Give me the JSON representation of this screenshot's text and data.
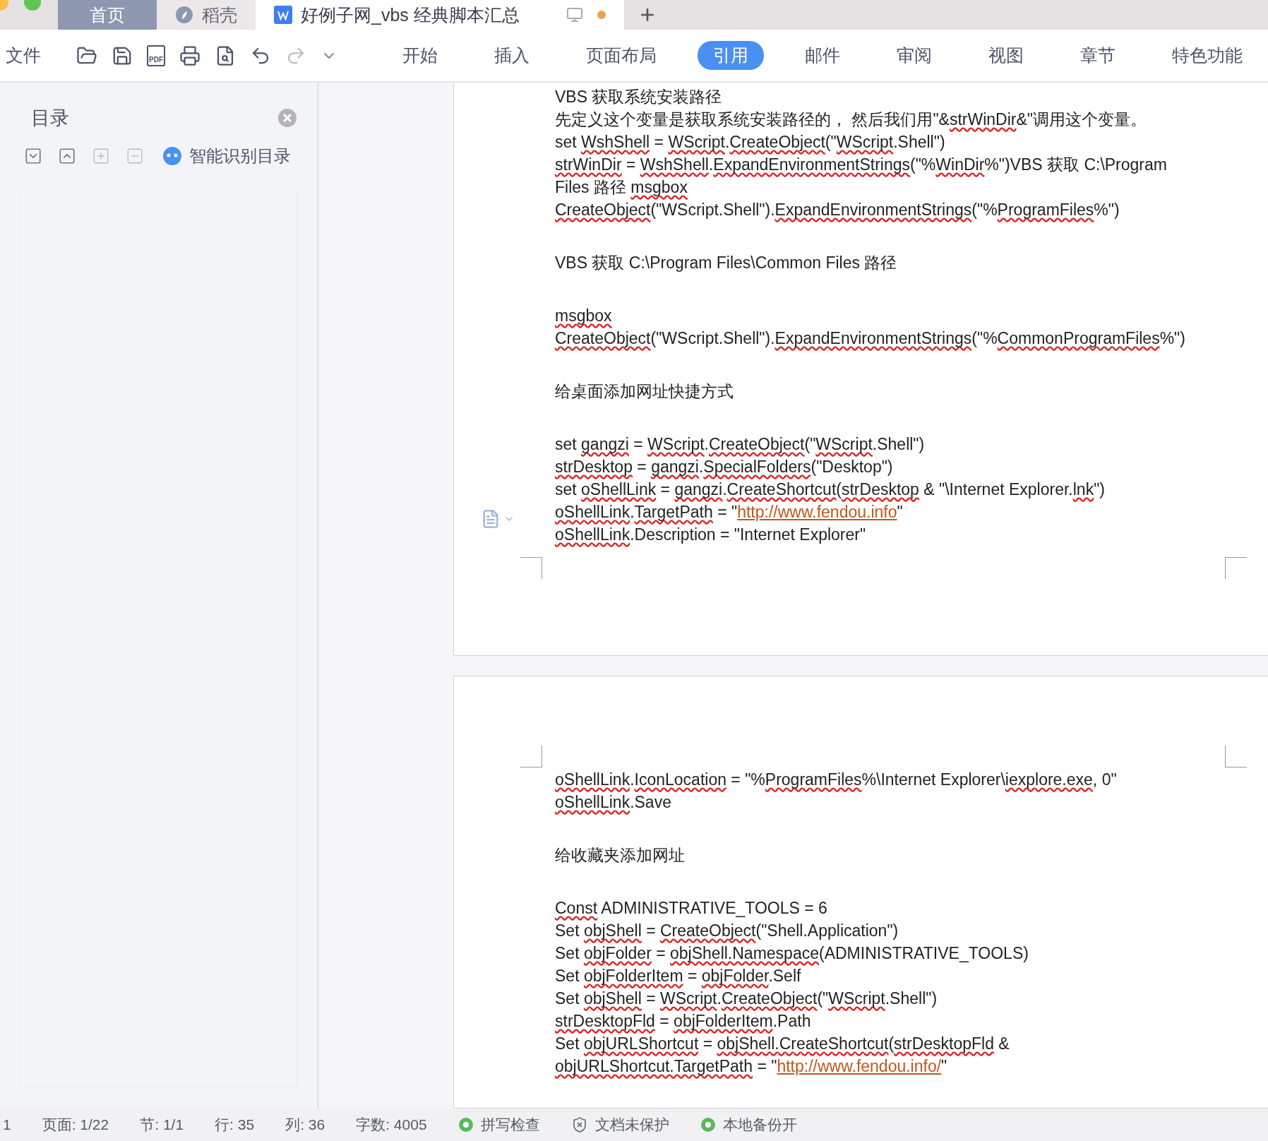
{
  "tab_bar": {
    "tabs": [
      {
        "label": "首页",
        "kind": "home",
        "selected": false
      },
      {
        "label": "稻壳",
        "kind": "store",
        "selected": false
      },
      {
        "label": "好例子网_vbs 经典脚本汇总",
        "kind": "document",
        "selected": true
      }
    ]
  },
  "toolbar": {
    "file_menu": "文件",
    "pdf_label": "PDF",
    "ribbon_tabs": [
      {
        "label": "开始",
        "selected": false
      },
      {
        "label": "插入",
        "selected": false
      },
      {
        "label": "页面布局",
        "selected": false
      },
      {
        "label": "引用",
        "selected": true
      },
      {
        "label": "邮件",
        "selected": false
      },
      {
        "label": "审阅",
        "selected": false
      },
      {
        "label": "视图",
        "selected": false
      },
      {
        "label": "章节",
        "selected": false
      },
      {
        "label": "特色功能",
        "selected": false
      }
    ]
  },
  "sidebar": {
    "title": "目录",
    "smart_button": "智能识别目录"
  },
  "pages": [
    {
      "blocks": [
        [
          [
            {
              "text": "VBS 获取系统安装路径",
              "kind": "plain"
            }
          ],
          [
            {
              "text": "先定义这个变量是获取系统安装路径的， 然后我们用\"&",
              "kind": "plain"
            },
            {
              "text": "strWinDir",
              "kind": "spell"
            },
            {
              "text": "&\"调用这个变量。",
              "kind": "plain"
            }
          ],
          [
            {
              "text": "set ",
              "kind": "plain"
            },
            {
              "text": "WshShell",
              "kind": "spell"
            },
            {
              "text": " = ",
              "kind": "plain"
            },
            {
              "text": "WScript",
              "kind": "spell"
            },
            {
              "text": ".",
              "kind": "plain"
            },
            {
              "text": "CreateObject",
              "kind": "spell"
            },
            {
              "text": "(\"",
              "kind": "plain"
            },
            {
              "text": "WScript",
              "kind": "spell"
            },
            {
              "text": ".Shell\")",
              "kind": "plain"
            }
          ],
          [
            {
              "text": "strWinDir",
              "kind": "spell"
            },
            {
              "text": " = ",
              "kind": "plain"
            },
            {
              "text": "WshShell",
              "kind": "spell"
            },
            {
              "text": ".",
              "kind": "plain"
            },
            {
              "text": "ExpandEnvironmentStrings",
              "kind": "spell"
            },
            {
              "text": "(\"%",
              "kind": "plain"
            },
            {
              "text": "WinDir",
              "kind": "spell"
            },
            {
              "text": "%\")VBS 获取 C:\\Program",
              "kind": "plain"
            }
          ],
          [
            {
              "text": "Files 路径 ",
              "kind": "plain"
            },
            {
              "text": "msgbox",
              "kind": "spell"
            }
          ],
          [
            {
              "text": "CreateObject",
              "kind": "spell"
            },
            {
              "text": "(\"WScript.Shell\").",
              "kind": "plain"
            },
            {
              "text": "ExpandEnvironmentStrings",
              "kind": "spell"
            },
            {
              "text": "(\"%",
              "kind": "plain"
            },
            {
              "text": "ProgramFiles",
              "kind": "spell"
            },
            {
              "text": "%\")",
              "kind": "plain"
            }
          ]
        ],
        [
          [
            {
              "text": "VBS 获取 C:\\Program Files\\Common Files 路径",
              "kind": "plain"
            }
          ]
        ],
        [
          [
            {
              "text": "msgbox",
              "kind": "spell"
            }
          ],
          [
            {
              "text": "CreateObject",
              "kind": "spell"
            },
            {
              "text": "(\"WScript.Shell\").",
              "kind": "plain"
            },
            {
              "text": "ExpandEnvironmentStrings",
              "kind": "spell"
            },
            {
              "text": "(\"%",
              "kind": "plain"
            },
            {
              "text": "CommonProgramFiles",
              "kind": "spell"
            },
            {
              "text": "%\")",
              "kind": "plain"
            }
          ]
        ],
        [
          [
            {
              "text": "给桌面添加网址快捷方式",
              "kind": "plain"
            }
          ]
        ],
        [
          [
            {
              "text": "set ",
              "kind": "plain"
            },
            {
              "text": "gangzi",
              "kind": "spell"
            },
            {
              "text": " = ",
              "kind": "plain"
            },
            {
              "text": "WScript",
              "kind": "spell"
            },
            {
              "text": ".",
              "kind": "plain"
            },
            {
              "text": "CreateObject",
              "kind": "spell"
            },
            {
              "text": "(\"",
              "kind": "plain"
            },
            {
              "text": "WScript",
              "kind": "spell"
            },
            {
              "text": ".Shell\")",
              "kind": "plain"
            }
          ],
          [
            {
              "text": "strDesktop",
              "kind": "spell"
            },
            {
              "text": " = ",
              "kind": "plain"
            },
            {
              "text": "gangzi",
              "kind": "spell"
            },
            {
              "text": ".",
              "kind": "plain"
            },
            {
              "text": "SpecialFolders",
              "kind": "spell"
            },
            {
              "text": "(\"Desktop\")",
              "kind": "plain"
            }
          ],
          [
            {
              "text": "set ",
              "kind": "plain"
            },
            {
              "text": "oShellLink",
              "kind": "spell"
            },
            {
              "text": " = ",
              "kind": "plain"
            },
            {
              "text": "gangzi",
              "kind": "spell"
            },
            {
              "text": ".",
              "kind": "plain"
            },
            {
              "text": "CreateShortcut",
              "kind": "spell"
            },
            {
              "text": "(",
              "kind": "plain"
            },
            {
              "text": "strDesktop",
              "kind": "spell"
            },
            {
              "text": " & \"\\Internet Explorer.",
              "kind": "plain"
            },
            {
              "text": "lnk",
              "kind": "spell"
            },
            {
              "text": "\")",
              "kind": "plain"
            }
          ],
          [
            {
              "text": "oShellLink",
              "kind": "spell"
            },
            {
              "text": ".",
              "kind": "plain"
            },
            {
              "text": "TargetPath",
              "kind": "spell"
            },
            {
              "text": " = \"",
              "kind": "plain"
            },
            {
              "text": "http://www.fendou.info",
              "kind": "link"
            },
            {
              "text": "\"",
              "kind": "plain"
            }
          ],
          [
            {
              "text": "oShellLink",
              "kind": "spell"
            },
            {
              "text": ".Description = \"Internet Explorer\"",
              "kind": "plain"
            }
          ]
        ]
      ]
    },
    {
      "blocks": [
        [
          [
            {
              "text": "oShellLink",
              "kind": "spell"
            },
            {
              "text": ".",
              "kind": "plain"
            },
            {
              "text": "IconLocation",
              "kind": "spell"
            },
            {
              "text": " = \"%",
              "kind": "plain"
            },
            {
              "text": "ProgramFiles",
              "kind": "spell"
            },
            {
              "text": "%\\Internet Explorer\\",
              "kind": "plain"
            },
            {
              "text": "iexplore.exe",
              "kind": "spell"
            },
            {
              "text": ", 0\"",
              "kind": "plain"
            }
          ],
          [
            {
              "text": "oShellLink",
              "kind": "spell"
            },
            {
              "text": ".Save",
              "kind": "plain"
            }
          ]
        ],
        [
          [
            {
              "text": "给收藏夹添加网址",
              "kind": "plain"
            }
          ]
        ],
        [
          [
            {
              "text": "Const",
              "kind": "spell"
            },
            {
              "text": " ADMINISTRATIVE_TOOLS = 6",
              "kind": "plain"
            }
          ],
          [
            {
              "text": "Set ",
              "kind": "plain"
            },
            {
              "text": "objShell",
              "kind": "spell"
            },
            {
              "text": " = ",
              "kind": "plain"
            },
            {
              "text": "CreateObject",
              "kind": "spell"
            },
            {
              "text": "(\"Shell.Application\")",
              "kind": "plain"
            }
          ],
          [
            {
              "text": "Set ",
              "kind": "plain"
            },
            {
              "text": "objFolder",
              "kind": "spell"
            },
            {
              "text": " = ",
              "kind": "plain"
            },
            {
              "text": "objShell.Namespace",
              "kind": "spell"
            },
            {
              "text": "(ADMINISTRATIVE_TOOLS)",
              "kind": "plain"
            }
          ],
          [
            {
              "text": "Set ",
              "kind": "plain"
            },
            {
              "text": "objFolderItem",
              "kind": "spell"
            },
            {
              "text": " = ",
              "kind": "plain"
            },
            {
              "text": "objFolder",
              "kind": "spell"
            },
            {
              "text": ".Self",
              "kind": "plain"
            }
          ],
          [
            {
              "text": "Set ",
              "kind": "plain"
            },
            {
              "text": "objShell",
              "kind": "spell"
            },
            {
              "text": " = ",
              "kind": "plain"
            },
            {
              "text": "WScript",
              "kind": "spell"
            },
            {
              "text": ".",
              "kind": "plain"
            },
            {
              "text": "CreateObject",
              "kind": "spell"
            },
            {
              "text": "(\"",
              "kind": "plain"
            },
            {
              "text": "WScript",
              "kind": "spell"
            },
            {
              "text": ".Shell\")",
              "kind": "plain"
            }
          ],
          [
            {
              "text": "strDesktopFld",
              "kind": "spell"
            },
            {
              "text": " = ",
              "kind": "plain"
            },
            {
              "text": "objFolderItem",
              "kind": "spell"
            },
            {
              "text": ".Path",
              "kind": "plain"
            }
          ],
          [
            {
              "text": "Set ",
              "kind": "plain"
            },
            {
              "text": "objURLShortcut",
              "kind": "spell"
            },
            {
              "text": " = ",
              "kind": "plain"
            },
            {
              "text": "objShell.CreateShortcut",
              "kind": "spell"
            },
            {
              "text": "(",
              "kind": "plain"
            },
            {
              "text": "strDesktopFld",
              "kind": "spell"
            },
            {
              "text": " &",
              "kind": "plain"
            }
          ],
          [
            {
              "text": "objURLShortcut.TargetPath",
              "kind": "spell"
            },
            {
              "text": " = \"",
              "kind": "plain"
            },
            {
              "text": "http://www.fendou.info/",
              "kind": "link"
            },
            {
              "text": "\"",
              "kind": "plain"
            }
          ]
        ]
      ]
    }
  ],
  "status_bar": {
    "items": [
      {
        "text": "1",
        "kind": "plain"
      },
      {
        "text": "页面: 1/22",
        "kind": "plain"
      },
      {
        "text": "节: 1/1",
        "kind": "plain"
      },
      {
        "text": "行: 35",
        "kind": "plain"
      },
      {
        "text": "列: 36",
        "kind": "plain"
      },
      {
        "text": "字数: 4005",
        "kind": "plain"
      },
      {
        "text": "拼写检查",
        "kind": "on"
      },
      {
        "text": "文档未保护",
        "kind": "shield"
      },
      {
        "text": "本地备份开",
        "kind": "on"
      }
    ]
  }
}
